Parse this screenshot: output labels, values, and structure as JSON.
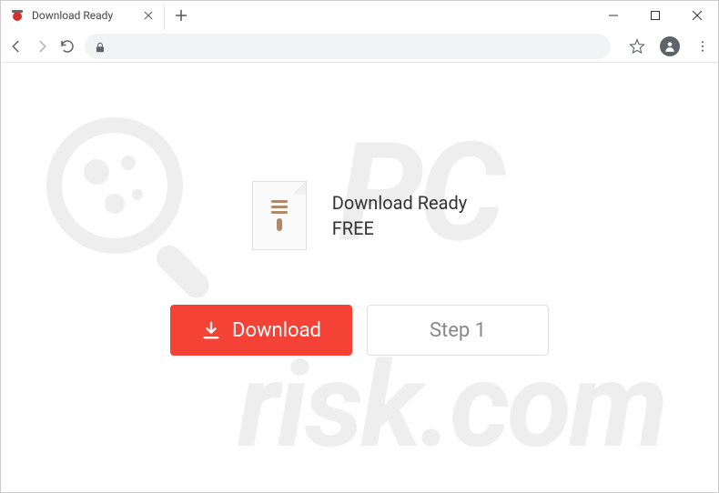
{
  "window": {
    "tab_title": "Download Ready"
  },
  "page": {
    "title_line1": "Download Ready",
    "title_line2": "FREE",
    "download_button": "Download",
    "step_button": "Step 1"
  },
  "watermark": {
    "pc": "PC",
    "risk": "risk.com"
  }
}
